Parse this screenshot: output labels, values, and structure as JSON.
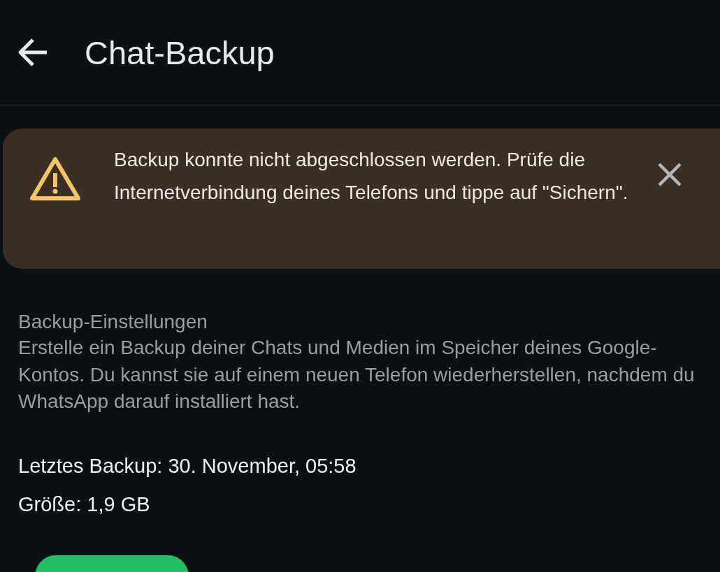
{
  "header": {
    "title": "Chat-Backup"
  },
  "banner": {
    "message": "Backup konnte nicht abgeschlossen werden. Prüfe die Internetverbindung deines Telefons und tippe auf \"Sichern\"."
  },
  "settings": {
    "heading": "Backup-Einstellungen",
    "description": "Erstelle ein Backup deiner Chats und Medien im Speicher deines Google-Kontos. Du kannst sie auf einem neuen Telefon wiederherstellen, nachdem du WhatsApp darauf installiert hast.",
    "last_backup": "Letztes Backup: 30. November, 05:58",
    "size": "Größe: 1,9 GB"
  }
}
